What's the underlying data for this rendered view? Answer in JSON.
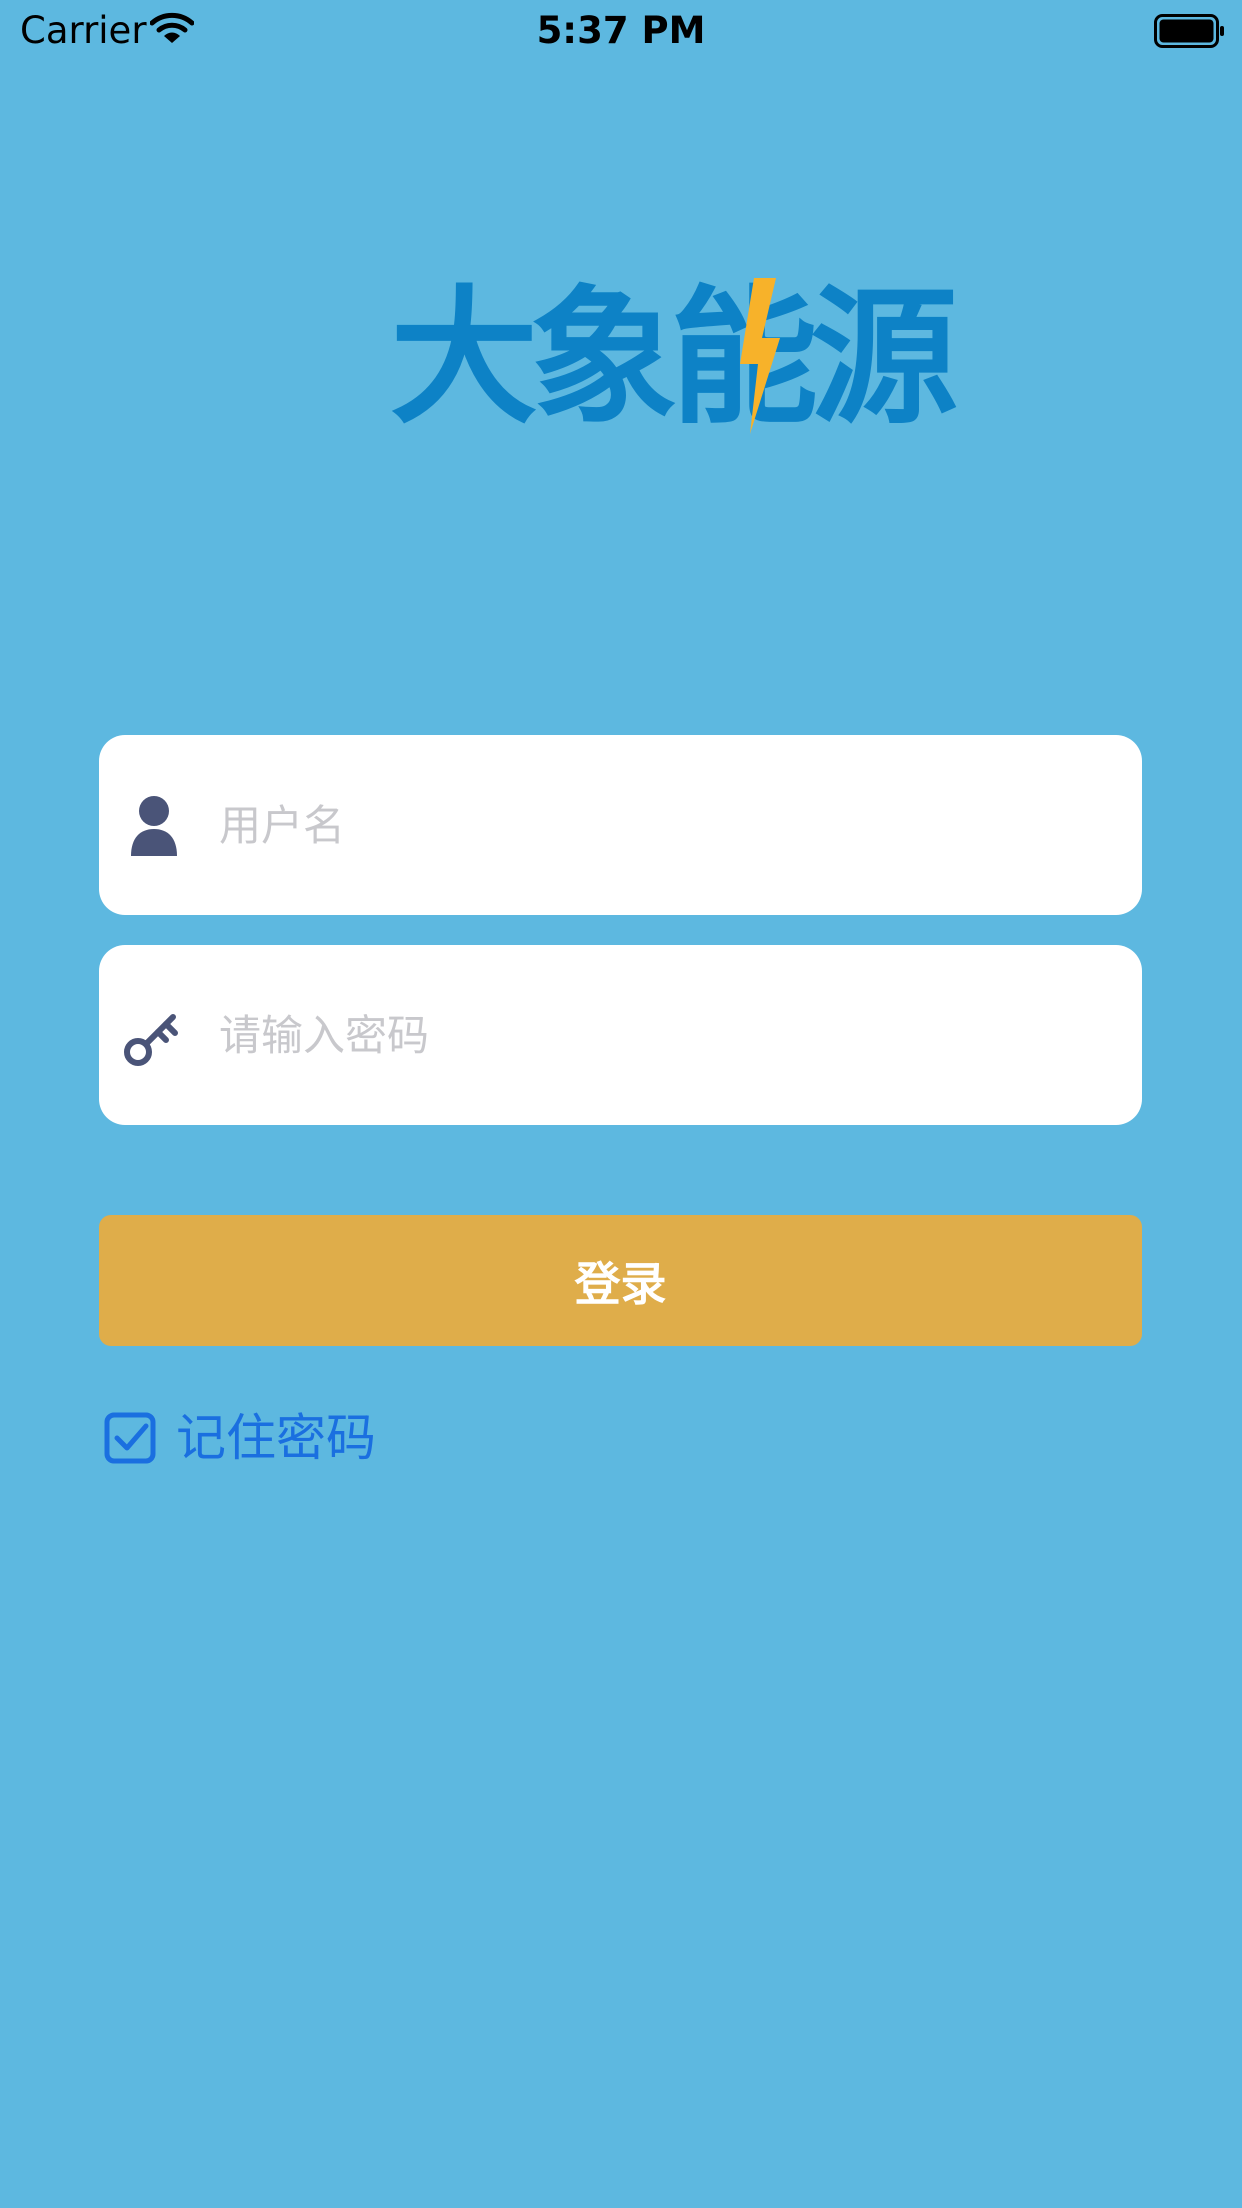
{
  "status_bar": {
    "carrier": "Carrier",
    "time": "5:37 PM",
    "wifi_icon": "wifi-icon",
    "battery_icon": "battery-icon"
  },
  "logo": {
    "text": "大象能源",
    "text_color": "#0d82c6",
    "bolt_color": "#f7b22a"
  },
  "form": {
    "username": {
      "placeholder": "用户名",
      "value": "",
      "icon": "user-icon"
    },
    "password": {
      "placeholder": "请输入密码",
      "value": "",
      "icon": "key-icon"
    },
    "login_label": "登录",
    "remember": {
      "label": "记住密码",
      "checked": true,
      "icon": "checkbox-checked-icon"
    }
  },
  "colors": {
    "background": "#5db8e0",
    "button": "#dfad4a",
    "field_background": "#ffffff",
    "icon": "#4a5478",
    "remember": "#1a6fe0"
  }
}
